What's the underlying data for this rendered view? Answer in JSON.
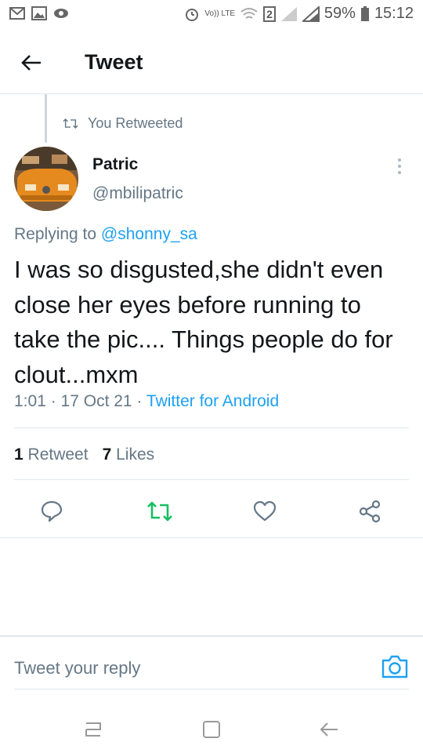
{
  "status_bar": {
    "battery": "59%",
    "time": "15:12",
    "sim_badge": "2",
    "volte": "Vo)) LTE"
  },
  "header": {
    "title": "Tweet"
  },
  "retweet_context": {
    "label": "You Retweeted"
  },
  "tweet": {
    "author_name": "Patric",
    "author_handle": "@mbilipatric",
    "replying_prefix": "Replying to",
    "replying_to": "@shonny_sa",
    "text": "I was so disgusted,she didn't even close her eyes before running to take the pic.... Things people do for clout...mxm",
    "time": "1:01",
    "date": "17 Oct 21",
    "source": "Twitter for Android",
    "retweet_count": "1",
    "retweet_label": "Retweet",
    "like_count": "7",
    "like_label": "Likes"
  },
  "composer": {
    "placeholder": "Tweet your reply"
  },
  "colors": {
    "accent": "#1da1f2",
    "retweet_active": "#17bf63",
    "secondary_text": "#657786",
    "divider": "#e1e8ed"
  },
  "icons": {
    "back": "arrow-left-icon",
    "retweet": "retweet-icon",
    "reply": "reply-icon",
    "like": "heart-icon",
    "share": "share-icon",
    "more": "more-vertical-icon",
    "camera": "camera-icon"
  }
}
